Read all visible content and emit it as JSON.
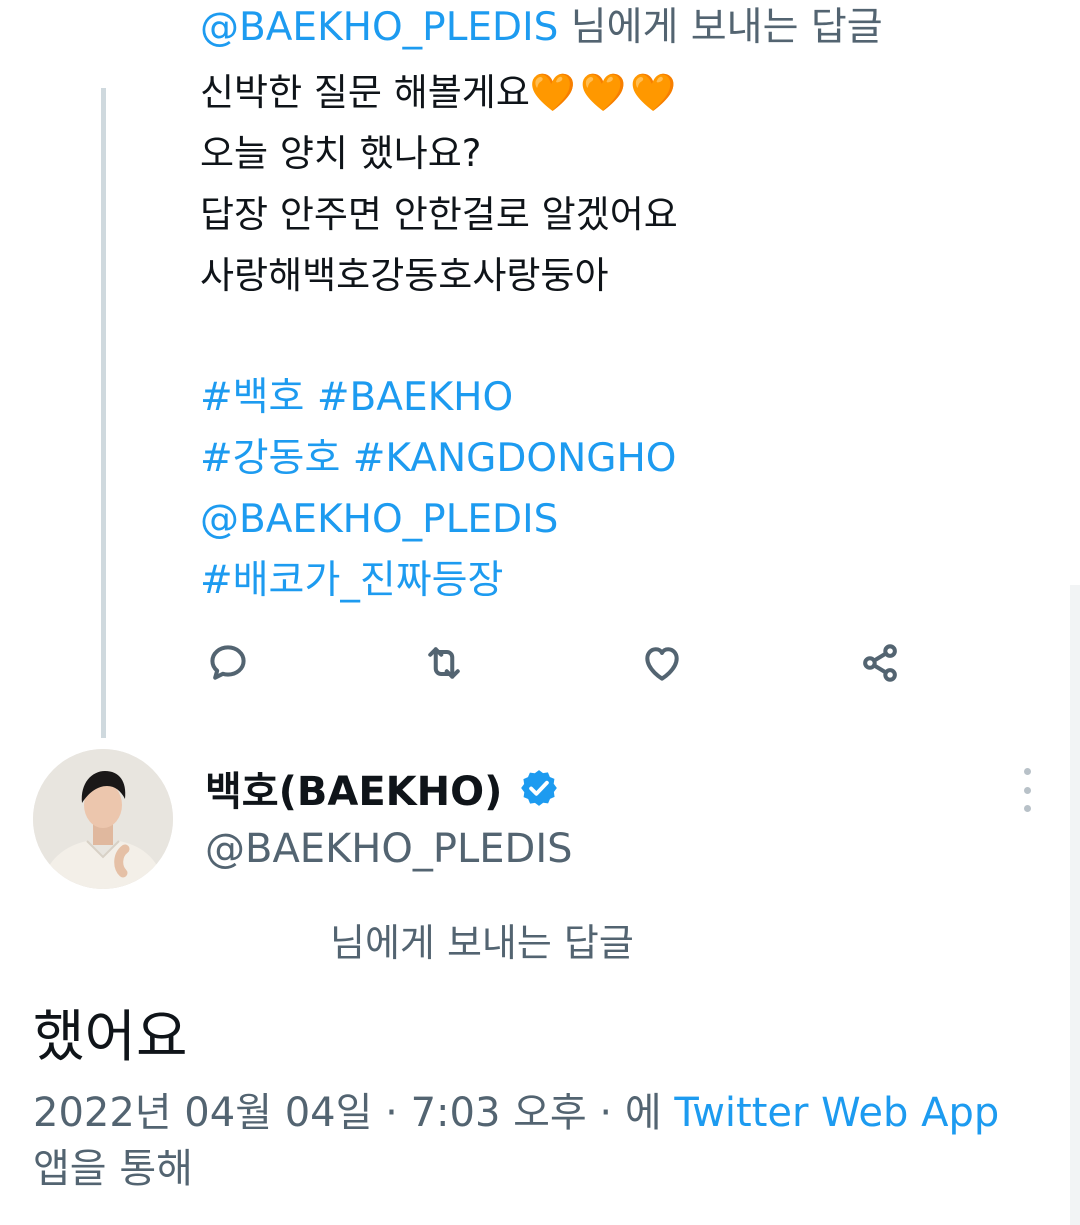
{
  "parent_tweet": {
    "replying_to_handle": "@BAEKHO_PLEDIS",
    "replying_to_suffix": "님에게 보내는 답글",
    "lines": [
      "신박한 질문 해볼게요",
      "오늘 양치 했나요?",
      "답장 안주면 안한걸로 알겠어요",
      "사랑해백호강동호사랑둥아"
    ],
    "hearts": "🧡🧡🧡",
    "hashtag_lines": [
      "#백호 #BAEKHO",
      "#강동호 #KANGDONGHO",
      "@BAEKHO_PLEDIS",
      "#배코가_진짜등장"
    ]
  },
  "actions": {
    "icons": [
      "reply-icon",
      "retweet-icon",
      "like-icon",
      "share-icon"
    ]
  },
  "reply_tweet": {
    "display_name": "백호(BAEKHO)",
    "handle": "@BAEKHO_PLEDIS",
    "verified": true,
    "replying_to_label": "님에게 보내는 답글",
    "text": "했어요",
    "timestamp": "2022년 04월 04일 · 7:03 오후 · 에",
    "source_app": "Twitter Web App",
    "source_suffix": "앱을 통해"
  },
  "colors": {
    "link": "#1d9bf0",
    "secondary_text": "#536471",
    "verified_badge": "#1d9bf0",
    "heart_emoji": "#f7931a"
  }
}
